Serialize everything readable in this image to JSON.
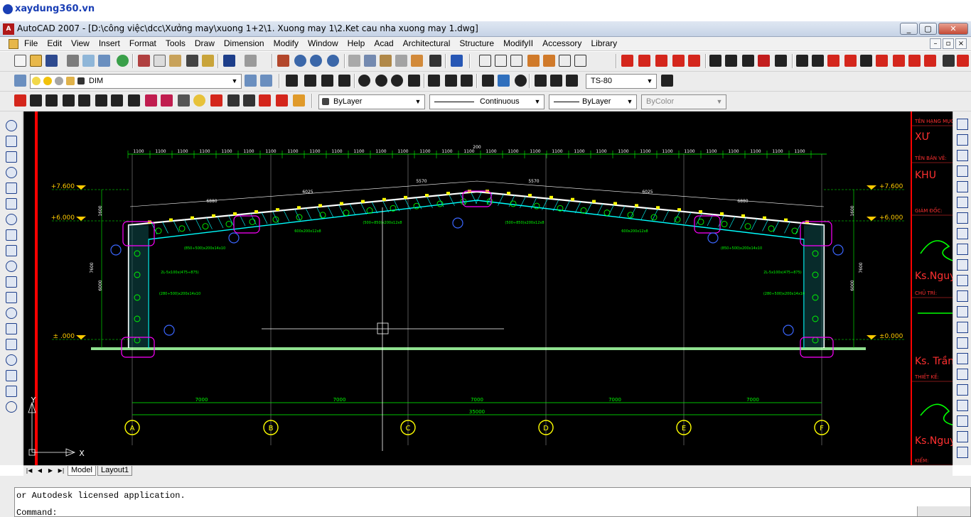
{
  "watermark": {
    "text": "xaydung360.vn"
  },
  "window": {
    "title": "AutoCAD 2007 - [D:\\công việc\\dcc\\Xưởng may\\xuong 1+2\\1. Xuong may 1\\2.Ket cau nha xuong may 1.dwg]",
    "minimize": "_",
    "maximize": "▢",
    "close": "✕",
    "doc_min": "–",
    "doc_restore": "▫",
    "doc_close": "×"
  },
  "menu": [
    "File",
    "Edit",
    "View",
    "Insert",
    "Format",
    "Tools",
    "Draw",
    "Dimension",
    "Modify",
    "Window",
    "Help",
    "Acad",
    "Architectural",
    "Structure",
    "ModifyII",
    "Accessory",
    "Library"
  ],
  "toolbar": {
    "layer": "DIM",
    "text_style": "TS-80",
    "color": "ByLayer",
    "linetype": "Continuous",
    "lineweight": "ByLayer",
    "plotstyle": "ByColor"
  },
  "tabs": {
    "model": "Model",
    "layout": "Layout1"
  },
  "command": {
    "history": "or Autodesk licensed application.",
    "prompt": "Command:"
  },
  "drawing": {
    "levels": [
      "+7.600",
      "+6.000",
      "± .000"
    ],
    "levels_right": [
      "+7.600",
      "+6.000",
      "±0.000"
    ],
    "spans": [
      "7000",
      "7000",
      "7000",
      "7000",
      "7000"
    ],
    "total_span": "35000",
    "axes": [
      "A",
      "B",
      "C",
      "D",
      "E",
      "F"
    ],
    "purlin_spacing": "1100",
    "rafter_lengths": [
      "6880",
      "6025",
      "5570",
      "5570",
      "6025",
      "6880"
    ],
    "ridge_dim": "200",
    "col_dims": [
      "7600",
      "6000",
      "1600"
    ],
    "section_labels": [
      "(850÷500)x200x14x10",
      "(500÷850)x200x12x8",
      "(500÷850)x200x12x8",
      "(850÷500)x200x14x10",
      "(280÷500)x200x14x10",
      "(280÷500)x200x14x10",
      "2L-5x100x(475÷875)",
      "2L-5x100x(475÷875)",
      "600x200x12x8",
      "600x200x12x8"
    ],
    "axis_x": "X",
    "axis_y": "Y"
  },
  "title_block": {
    "rows": [
      "TÊN HẠNG MỤC:",
      "XƯ",
      "TÊN BẢN VẼ:",
      "KHU",
      "GIÁM ĐỐC:",
      "Ks.Nguyễ",
      "CHỦ TRÌ:",
      "Ks. Trần",
      "THIẾT KẾ:",
      "Ks.Nguyễ",
      "KIỂM:"
    ]
  },
  "colors": {
    "canvas": "#000000",
    "frame": "#ffffff",
    "dimension": "#00ff00",
    "level_marker": "#ffcc00",
    "border_red": "#ff0000",
    "member": "#00ffff",
    "bolt": "#ffff00",
    "highlight": "#ff00ff"
  }
}
